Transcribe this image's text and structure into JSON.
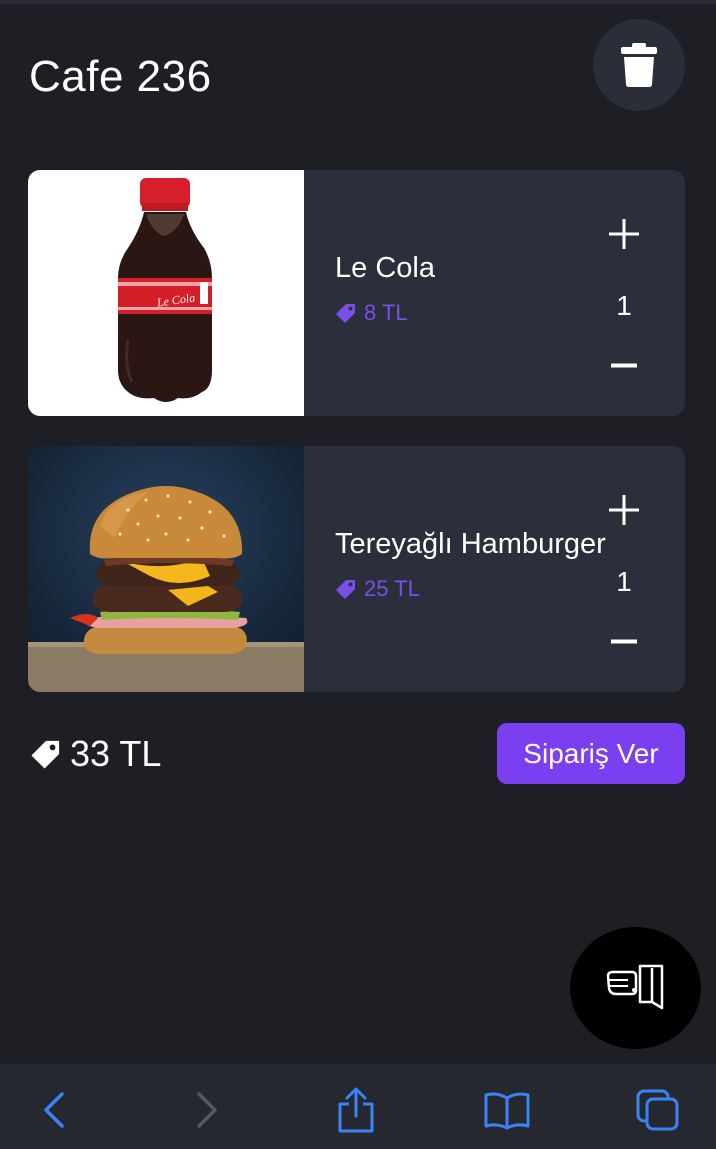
{
  "header": {
    "title": "Cafe 236",
    "delete_icon": "trash-icon"
  },
  "cart": {
    "items": [
      {
        "name": "Le Cola",
        "price": "8 TL",
        "quantity": "1",
        "image": "cola-bottle"
      },
      {
        "name": "Tereyağlı Hamburger",
        "price": "25 TL",
        "quantity": "1",
        "image": "burger"
      }
    ],
    "bottle_label": "Le Cola",
    "plus_icon": "plus-icon",
    "minus_icon": "minus-icon",
    "price_icon": "price-tag-icon"
  },
  "summary": {
    "total": "33 TL",
    "order_button": "Sipariş Ver"
  },
  "fab": {
    "icon": "exit-door-icon"
  },
  "browser_bar": {
    "icons": [
      "back-arrow-icon",
      "forward-arrow-icon",
      "share-icon",
      "bookmarks-icon",
      "tabs-icon"
    ]
  },
  "colors": {
    "background": "#1e1f24",
    "card": "#2b2e3b",
    "accent": "#7b3ff2",
    "price": "#7a4fe8",
    "browser_icon": "#3b82f6"
  }
}
